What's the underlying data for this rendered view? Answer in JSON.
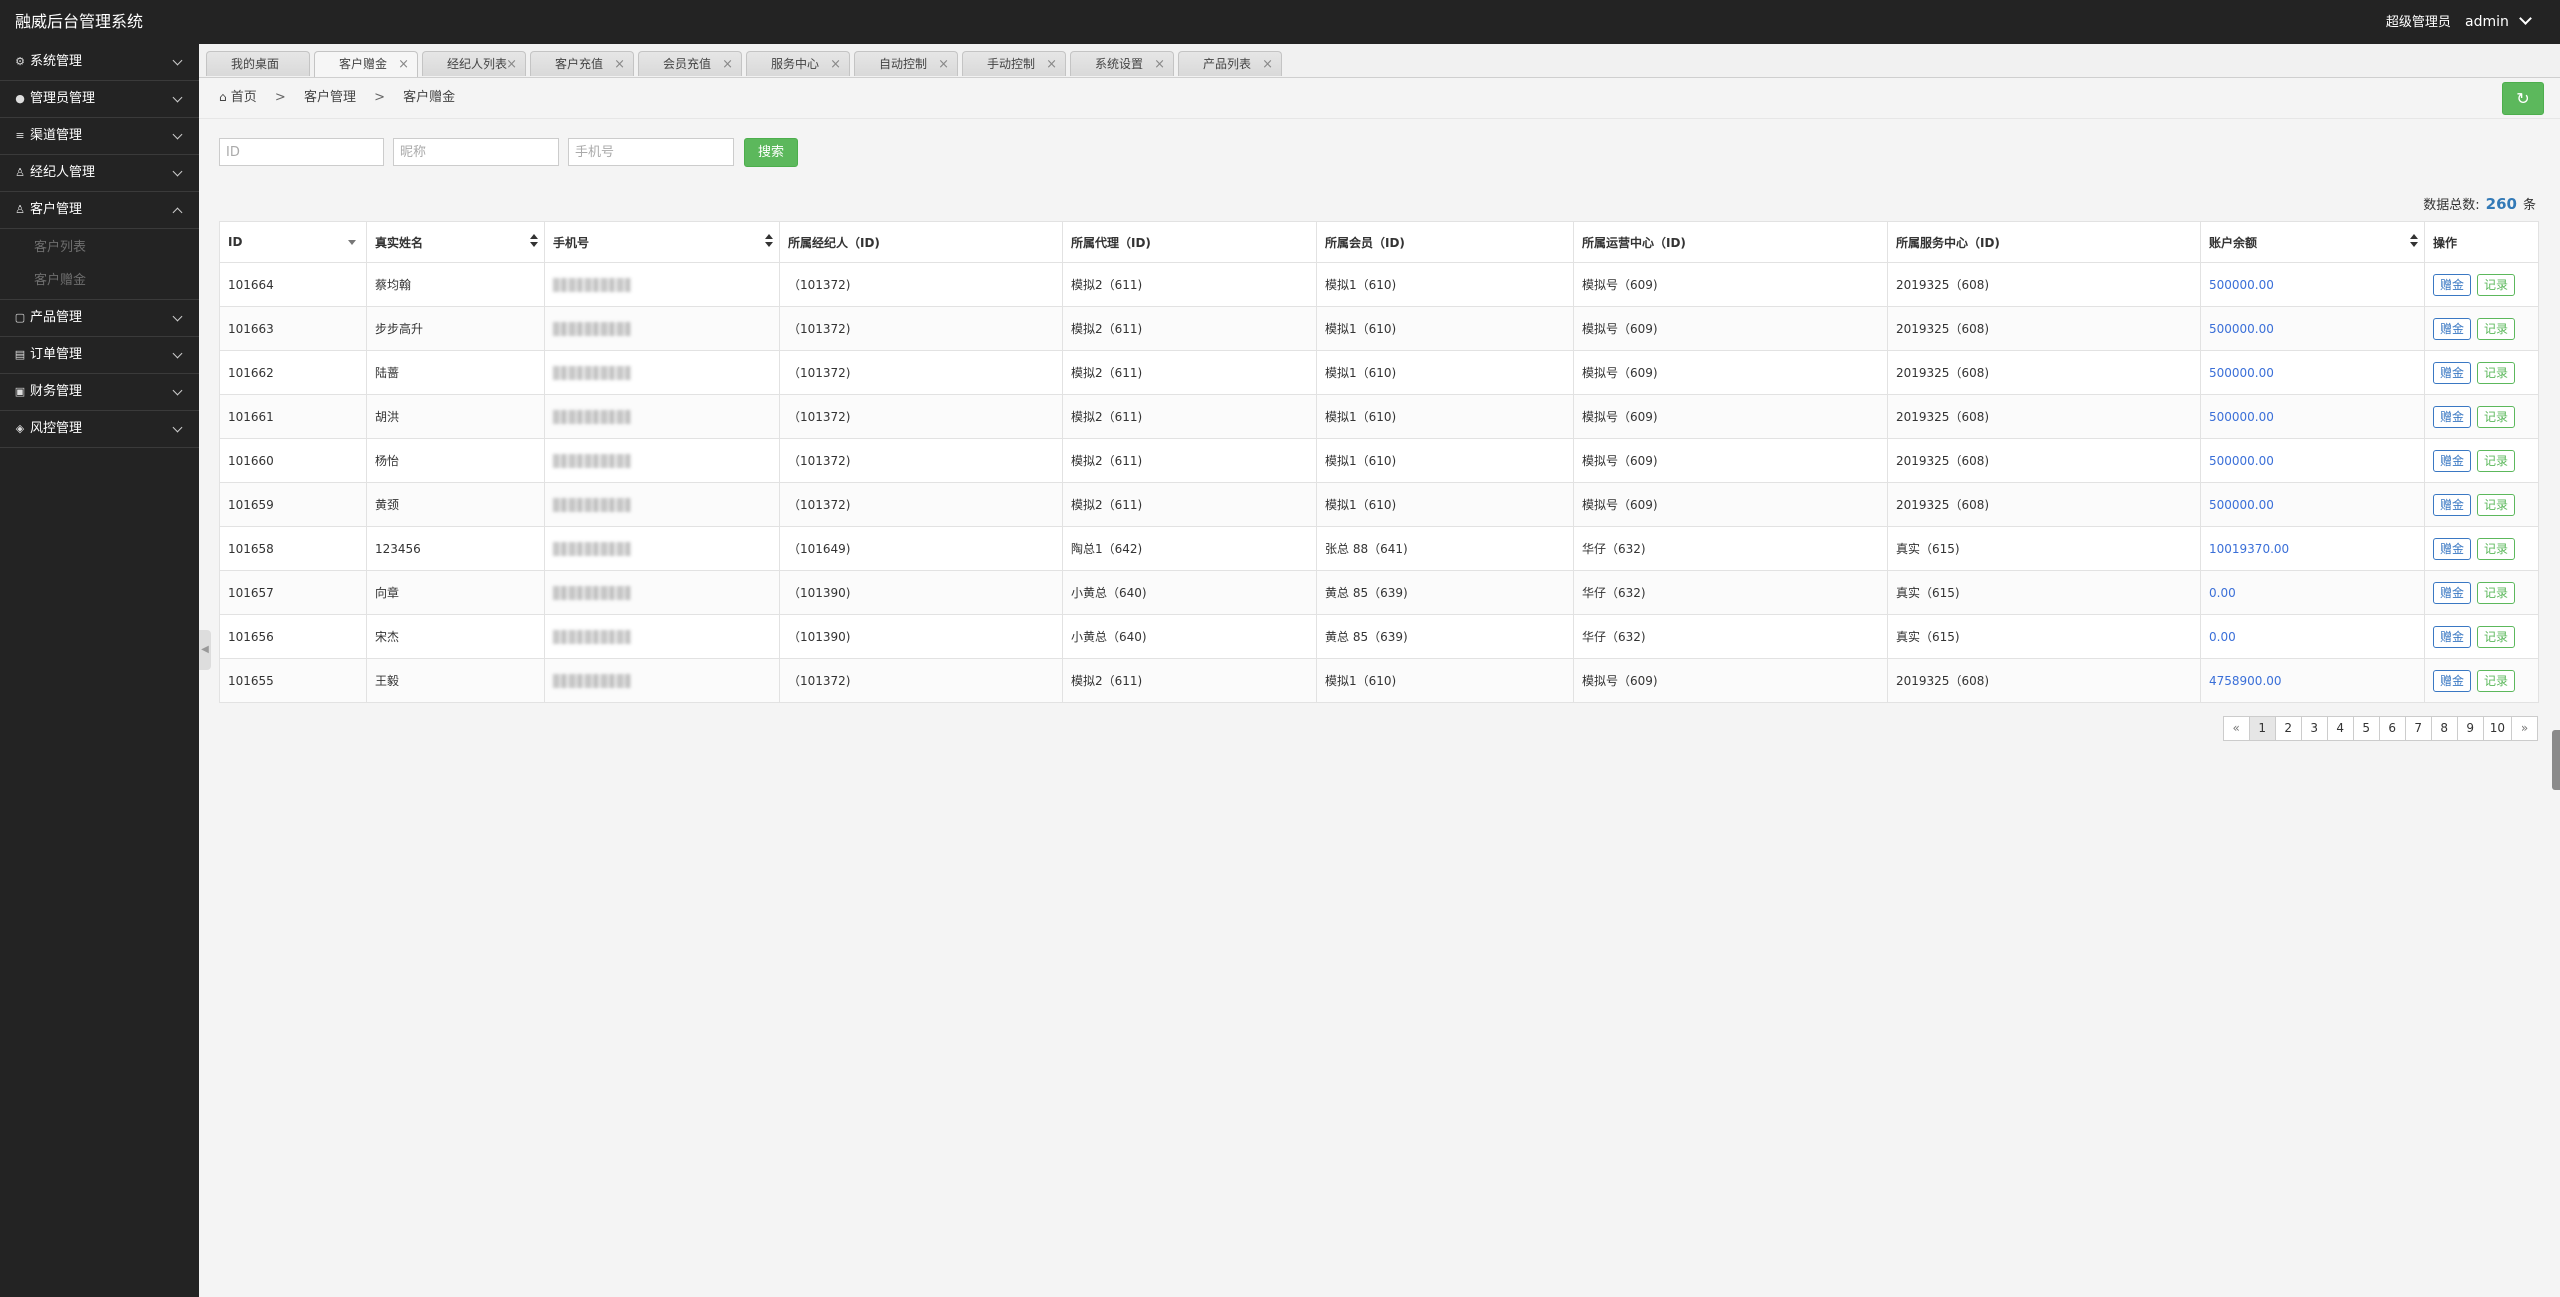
{
  "app": {
    "title": "融威后台管理系统",
    "role": "超级管理员",
    "user": "admin"
  },
  "sidebar": {
    "items": [
      {
        "label": "系统管理",
        "icon": "gear-icon"
      },
      {
        "label": "管理员管理",
        "icon": "user-icon"
      },
      {
        "label": "渠道管理",
        "icon": "channel-icon"
      },
      {
        "label": "经纪人管理",
        "icon": "agent-icon"
      },
      {
        "label": "客户管理",
        "icon": "customer-icon",
        "expanded": true,
        "children": [
          {
            "label": "客户列表"
          },
          {
            "label": "客户赠金"
          }
        ]
      },
      {
        "label": "产品管理",
        "icon": "product-icon"
      },
      {
        "label": "订单管理",
        "icon": "order-icon"
      },
      {
        "label": "财务管理",
        "icon": "finance-icon"
      },
      {
        "label": "风控管理",
        "icon": "shield-icon"
      }
    ]
  },
  "tabs": [
    {
      "label": "我的桌面"
    },
    {
      "label": "客户赠金",
      "active": true
    },
    {
      "label": "经纪人列表"
    },
    {
      "label": "客户充值"
    },
    {
      "label": "会员充值"
    },
    {
      "label": "服务中心"
    },
    {
      "label": "自动控制"
    },
    {
      "label": "手动控制"
    },
    {
      "label": "系统设置"
    },
    {
      "label": "产品列表"
    }
  ],
  "tab_close": "×",
  "breadcrumb": {
    "home": "首页",
    "sep": ">",
    "level1": "客户管理",
    "level2": "客户赠金"
  },
  "search": {
    "id_placeholder": "ID",
    "nickname_placeholder": "昵称",
    "phone_placeholder": "手机号",
    "button": "搜索"
  },
  "summary": {
    "label": "数据总数:",
    "count": "260",
    "unit": "条"
  },
  "table": {
    "headers": [
      "ID",
      "真实姓名",
      "手机号",
      "所属经纪人（ID)",
      "所属代理（ID)",
      "所属会员（ID)",
      "所属运营中心（ID)",
      "所属服务中心（ID)",
      "账户余额",
      "操作"
    ],
    "gift_label": "赠金",
    "record_label": "记录",
    "rows": [
      {
        "id": "101664",
        "name": "蔡均翰",
        "broker": "（101372)",
        "agent": "模拟2（611)",
        "member": "模拟1（610)",
        "ops": "模拟号（609)",
        "service": "2019325（608)",
        "balance": "500000.00"
      },
      {
        "id": "101663",
        "name": "步步高升",
        "broker": "（101372)",
        "agent": "模拟2（611)",
        "member": "模拟1（610)",
        "ops": "模拟号（609)",
        "service": "2019325（608)",
        "balance": "500000.00"
      },
      {
        "id": "101662",
        "name": "陆蔷",
        "broker": "（101372)",
        "agent": "模拟2（611)",
        "member": "模拟1（610)",
        "ops": "模拟号（609)",
        "service": "2019325（608)",
        "balance": "500000.00"
      },
      {
        "id": "101661",
        "name": "胡洪",
        "broker": "（101372)",
        "agent": "模拟2（611)",
        "member": "模拟1（610)",
        "ops": "模拟号（609)",
        "service": "2019325（608)",
        "balance": "500000.00"
      },
      {
        "id": "101660",
        "name": "杨怡",
        "broker": "（101372)",
        "agent": "模拟2（611)",
        "member": "模拟1（610)",
        "ops": "模拟号（609)",
        "service": "2019325（608)",
        "balance": "500000.00"
      },
      {
        "id": "101659",
        "name": "黄颈",
        "broker": "（101372)",
        "agent": "模拟2（611)",
        "member": "模拟1（610)",
        "ops": "模拟号（609)",
        "service": "2019325（608)",
        "balance": "500000.00"
      },
      {
        "id": "101658",
        "name": "123456",
        "broker": "（101649)",
        "agent": "陶总1（642)",
        "member": "张总 88（641)",
        "ops": "华仔（632)",
        "service": "真实（615)",
        "balance": "10019370.00"
      },
      {
        "id": "101657",
        "name": "向章",
        "broker": "（101390)",
        "agent": "小黄总（640)",
        "member": "黄总 85（639)",
        "ops": "华仔（632)",
        "service": "真实（615)",
        "balance": "0.00"
      },
      {
        "id": "101656",
        "name": "宋杰",
        "broker": "（101390)",
        "agent": "小黄总（640)",
        "member": "黄总 85（639)",
        "ops": "华仔（632)",
        "service": "真实（615)",
        "balance": "0.00"
      },
      {
        "id": "101655",
        "name": "王毅",
        "broker": "（101372)",
        "agent": "模拟2（611)",
        "member": "模拟1（610)",
        "ops": "模拟号（609)",
        "service": "2019325（608)",
        "balance": "4758900.00"
      }
    ]
  },
  "pagination": {
    "prev": "«",
    "next": "»",
    "pages": [
      "1",
      "2",
      "3",
      "4",
      "5",
      "6",
      "7",
      "8",
      "9",
      "10"
    ],
    "current": "1"
  },
  "colors": {
    "accent_green": "#5cb85c",
    "link_blue": "#3a6fd8",
    "dark": "#232323"
  }
}
